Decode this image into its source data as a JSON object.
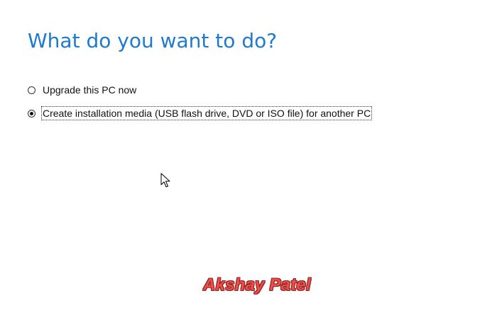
{
  "page": {
    "title": "What do you want to do?"
  },
  "options": [
    {
      "label": "Upgrade this PC now",
      "selected": false
    },
    {
      "label": "Create installation media (USB flash drive, DVD or ISO file) for another PC",
      "selected": true
    }
  ],
  "watermark": {
    "text": "Akshay Patel"
  },
  "colors": {
    "title": "#1e7ad0",
    "watermark": "#ee4e4a",
    "background": "#ffffff"
  },
  "icons": {
    "cursor": "mouse-pointer-icon",
    "radio_selected": "radio-selected-icon",
    "radio_unselected": "radio-unselected-icon"
  }
}
